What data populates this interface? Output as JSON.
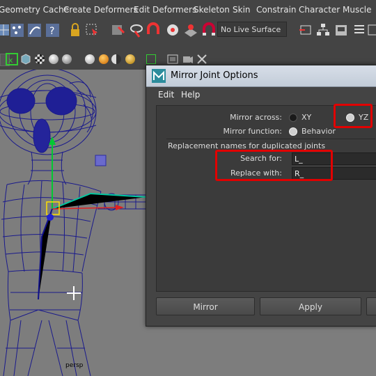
{
  "menubar": {
    "items": [
      "Geometry Cache",
      "Create Deformers",
      "Edit Deformers",
      "Skeleton",
      "Skin",
      "Constrain",
      "Character",
      "Muscle"
    ]
  },
  "toolbar": {
    "live_surface": "No Live Surface"
  },
  "viewport": {
    "camera_label": "persp"
  },
  "dialog": {
    "title": "Mirror Joint Options",
    "menu": [
      "Edit",
      "Help"
    ],
    "mirror_across_label": "Mirror across:",
    "mirror_across_options": [
      "XY",
      "YZ"
    ],
    "mirror_across_selected": "YZ",
    "mirror_function_label": "Mirror function:",
    "mirror_function_option": "Behavior",
    "replacement_section": "Replacement names for duplicated joints",
    "search_label": "Search for:",
    "search_value": "L_",
    "replace_label": "Replace with:",
    "replace_value": "R_",
    "buttons": [
      "Mirror",
      "Apply"
    ]
  },
  "colors": {
    "highlight": "#e10000",
    "wireframe": "#1a1a8c",
    "joint": "#00c832"
  }
}
